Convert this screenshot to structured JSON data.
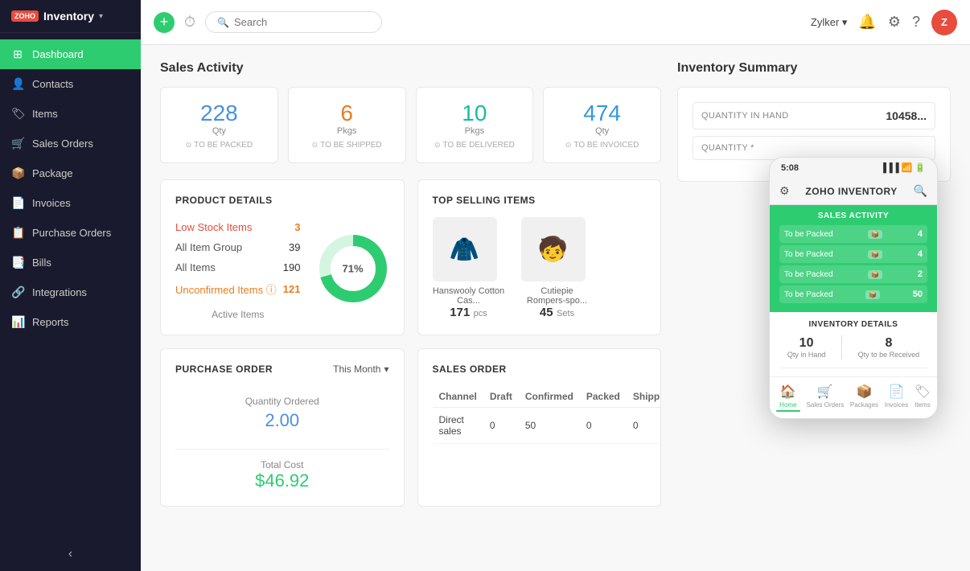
{
  "app": {
    "name": "Inventory",
    "org": "Zylker"
  },
  "topbar": {
    "search_placeholder": "Search"
  },
  "sidebar": {
    "items": [
      {
        "id": "dashboard",
        "label": "Dashboard",
        "icon": "⊞",
        "active": true
      },
      {
        "id": "contacts",
        "label": "Contacts",
        "icon": "👤"
      },
      {
        "id": "items",
        "label": "Items",
        "icon": "🏷"
      },
      {
        "id": "sales-orders",
        "label": "Sales Orders",
        "icon": "🛒"
      },
      {
        "id": "package",
        "label": "Package",
        "icon": "📦"
      },
      {
        "id": "invoices",
        "label": "Invoices",
        "icon": "📄"
      },
      {
        "id": "purchase-orders",
        "label": "Purchase Orders",
        "icon": "📋"
      },
      {
        "id": "bills",
        "label": "Bills",
        "icon": "📑"
      },
      {
        "id": "integrations",
        "label": "Integrations",
        "icon": "🔗"
      },
      {
        "id": "reports",
        "label": "Reports",
        "icon": "📊"
      }
    ]
  },
  "sales_activity": {
    "title": "Sales Activity",
    "cards": [
      {
        "number": "228",
        "label": "Qty",
        "sublabel": "TO BE PACKED",
        "color": "blue"
      },
      {
        "number": "6",
        "label": "Pkgs",
        "sublabel": "TO BE SHIPPED",
        "color": "orange"
      },
      {
        "number": "10",
        "label": "Pkgs",
        "sublabel": "TO BE DELIVERED",
        "color": "teal"
      },
      {
        "number": "474",
        "label": "Qty",
        "sublabel": "TO BE INVOICED",
        "color": "cyan"
      }
    ]
  },
  "inventory_summary": {
    "title": "Inventory Summary",
    "rows": [
      {
        "label": "QUANTITY IN HAND",
        "value": "10458..."
      },
      {
        "label": "QUANTITY *",
        "value": ""
      }
    ]
  },
  "product_details": {
    "title": "PRODUCT DETAILS",
    "rows": [
      {
        "label": "Low Stock Items",
        "value": "3",
        "highlight": "orange"
      },
      {
        "label": "All Item Group",
        "value": "39",
        "highlight": null
      },
      {
        "label": "All Items",
        "value": "190",
        "highlight": null
      },
      {
        "label": "Unconfirmed Items ⓘ",
        "value": "121",
        "highlight": "orange"
      }
    ],
    "donut": {
      "label": "Active Items",
      "percent": 71,
      "color_active": "#2ecc71",
      "color_inactive": "#d5f5e3"
    }
  },
  "top_selling": {
    "title": "TOP SELLING ITEMS",
    "items": [
      {
        "name": "Hanswooly Cotton Cas...",
        "qty": "171",
        "unit": "pcs",
        "emoji": "🧥"
      },
      {
        "name": "Cutiepie Rompers-spo...",
        "qty": "45",
        "unit": "Sets",
        "emoji": "🧒"
      }
    ]
  },
  "purchase_order": {
    "title": "PURCHASE ORDER",
    "filter": "This Month",
    "qty_label": "Quantity Ordered",
    "qty_value": "2.00",
    "total_label": "Total Cost",
    "total_value": "$46.92"
  },
  "sales_order": {
    "title": "SALES ORDER",
    "columns": [
      "Channel",
      "Draft",
      "Confirmed",
      "Packed",
      "Shipp..."
    ],
    "rows": [
      {
        "channel": "Direct sales",
        "draft": "0",
        "confirmed": "50",
        "packed": "0",
        "shipped": "0"
      }
    ]
  },
  "mobile": {
    "time": "5:08",
    "app_name": "ZOHO INVENTORY",
    "sales_activity_title": "SALES ACTIVITY",
    "sa_rows": [
      {
        "label": "To be Packed",
        "icon": "📦",
        "value": "4"
      },
      {
        "label": "To be Packed",
        "icon": "📦",
        "value": "4"
      },
      {
        "label": "To be Packed",
        "icon": "📦",
        "value": "2"
      },
      {
        "label": "To be Packed",
        "icon": "📦",
        "value": "50"
      }
    ],
    "inv_title": "INVENTORY DETAILS",
    "qty_hand": "10",
    "qty_hand_label": "Qty in Hand",
    "qty_receive": "8",
    "qty_receive_label": "Qty to be Received",
    "nav": [
      "Home",
      "Sales Orders",
      "Packages",
      "Invoices",
      "Items"
    ]
  }
}
